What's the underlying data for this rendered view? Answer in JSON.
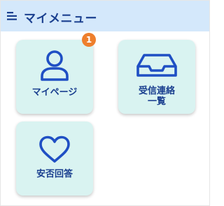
{
  "header": {
    "title": "マイメニュー",
    "menu_icon": "list-menu-icon"
  },
  "tiles": [
    {
      "label": "マイページ",
      "icon": "person-icon",
      "badge": "1"
    },
    {
      "label_line1": "受信連絡",
      "label_line2": "一覧",
      "icon": "inbox-tray-icon"
    },
    {
      "label": "安否回答",
      "icon": "heart-outline-icon"
    }
  ],
  "colors": {
    "header_bg": "#d4e8fb",
    "tile_bg": "#d9f3f1",
    "accent": "#1a3f8f",
    "icon": "#1f4fc4",
    "badge": "#ee7f2d"
  }
}
